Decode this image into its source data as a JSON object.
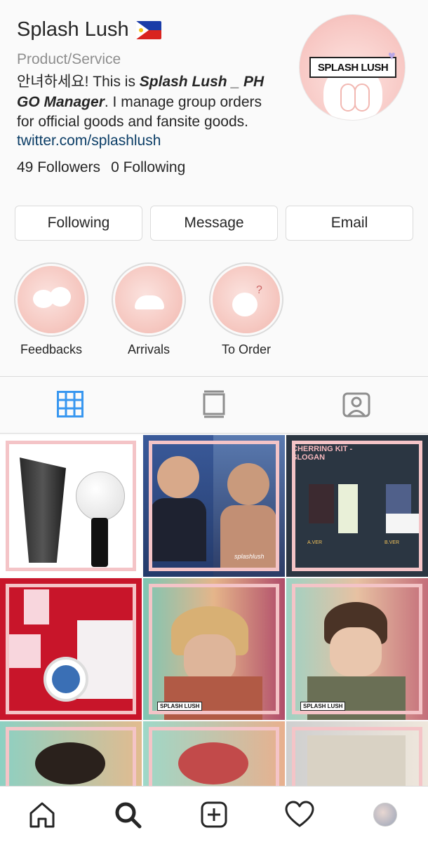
{
  "profile": {
    "name": "Splash Lush",
    "category": "Product/Service",
    "bio_intro": "안녀하세요! This is ",
    "bio_bold": "Splash Lush _ PH GO Manager",
    "bio_rest": ". I manage group orders for official goods and fansite goods.",
    "link": "twitter.com/splashlush",
    "followers": "49 Followers",
    "following": "0 Following",
    "avatar_logo": "SPLASH LUSH"
  },
  "actions": {
    "following": "Following",
    "message": "Message",
    "email": "Email"
  },
  "highlights": [
    {
      "label": "Feedbacks"
    },
    {
      "label": "Arrivals"
    },
    {
      "label": "To Order"
    }
  ],
  "posts": {
    "p3_title": "CHERRING KIT - SLOGAN",
    "p3_a": "A.VER",
    "p3_b": "B.VER",
    "watermark": "splashlush",
    "tag": "SPLASH LUSH"
  },
  "colors": {
    "accent": "#3897f0",
    "link": "#0b3d66",
    "frame": "#f4c4c7"
  }
}
